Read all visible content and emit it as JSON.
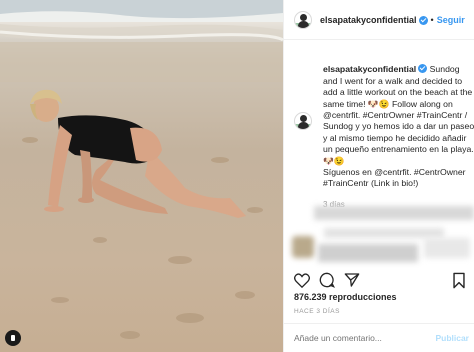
{
  "post": {
    "username": "elsapatakyconfidential",
    "separator": "•",
    "follow_label": "Seguir",
    "caption": {
      "username": "elsapatakyconfidential",
      "text": "Sundog and I went for a walk and decided to add a little workout on the beach at the same time! 🐶😉 Follow along on @centrfit. #CentrOwner #TrainCentr / Sundog y yo hemos ido a dar un paseo y al mismo tiempo he decidido añadir un pequeño entrenamiento en la playa. 🐶😉\nSíguenos en @centrfit. #CentrOwner #TrainCentr (Link in bio!)"
    },
    "time_ago": "3 días",
    "views": "876.239 reproducciones",
    "date": "HACE 3 DÍAS",
    "comment_placeholder": "Añade un comentario...",
    "publish_label": "Publicar"
  },
  "icons": {
    "like": "heart-icon",
    "comment": "comment-bubble-icon",
    "share": "share-icon",
    "save": "bookmark-icon",
    "video": "video-indicator-icon",
    "verified": "verified-badge-icon"
  },
  "colors": {
    "link": "#3897f0",
    "hashtag": "#003569",
    "muted": "#999999",
    "publish_disabled": "#b2dffc"
  }
}
